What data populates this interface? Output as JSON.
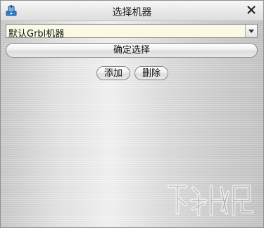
{
  "window": {
    "title": "选择机器"
  },
  "machine_select": {
    "value": "默认Grbl机器"
  },
  "buttons": {
    "confirm_label": "确定选择",
    "add_label": "添加",
    "delete_label": "删除"
  },
  "icons": {
    "app": "app-icon",
    "close": "close-icon",
    "dropdown": "chevron-down-icon"
  },
  "colors": {
    "select_bg": "#f9f9e6",
    "border": "#8a8a8a"
  }
}
